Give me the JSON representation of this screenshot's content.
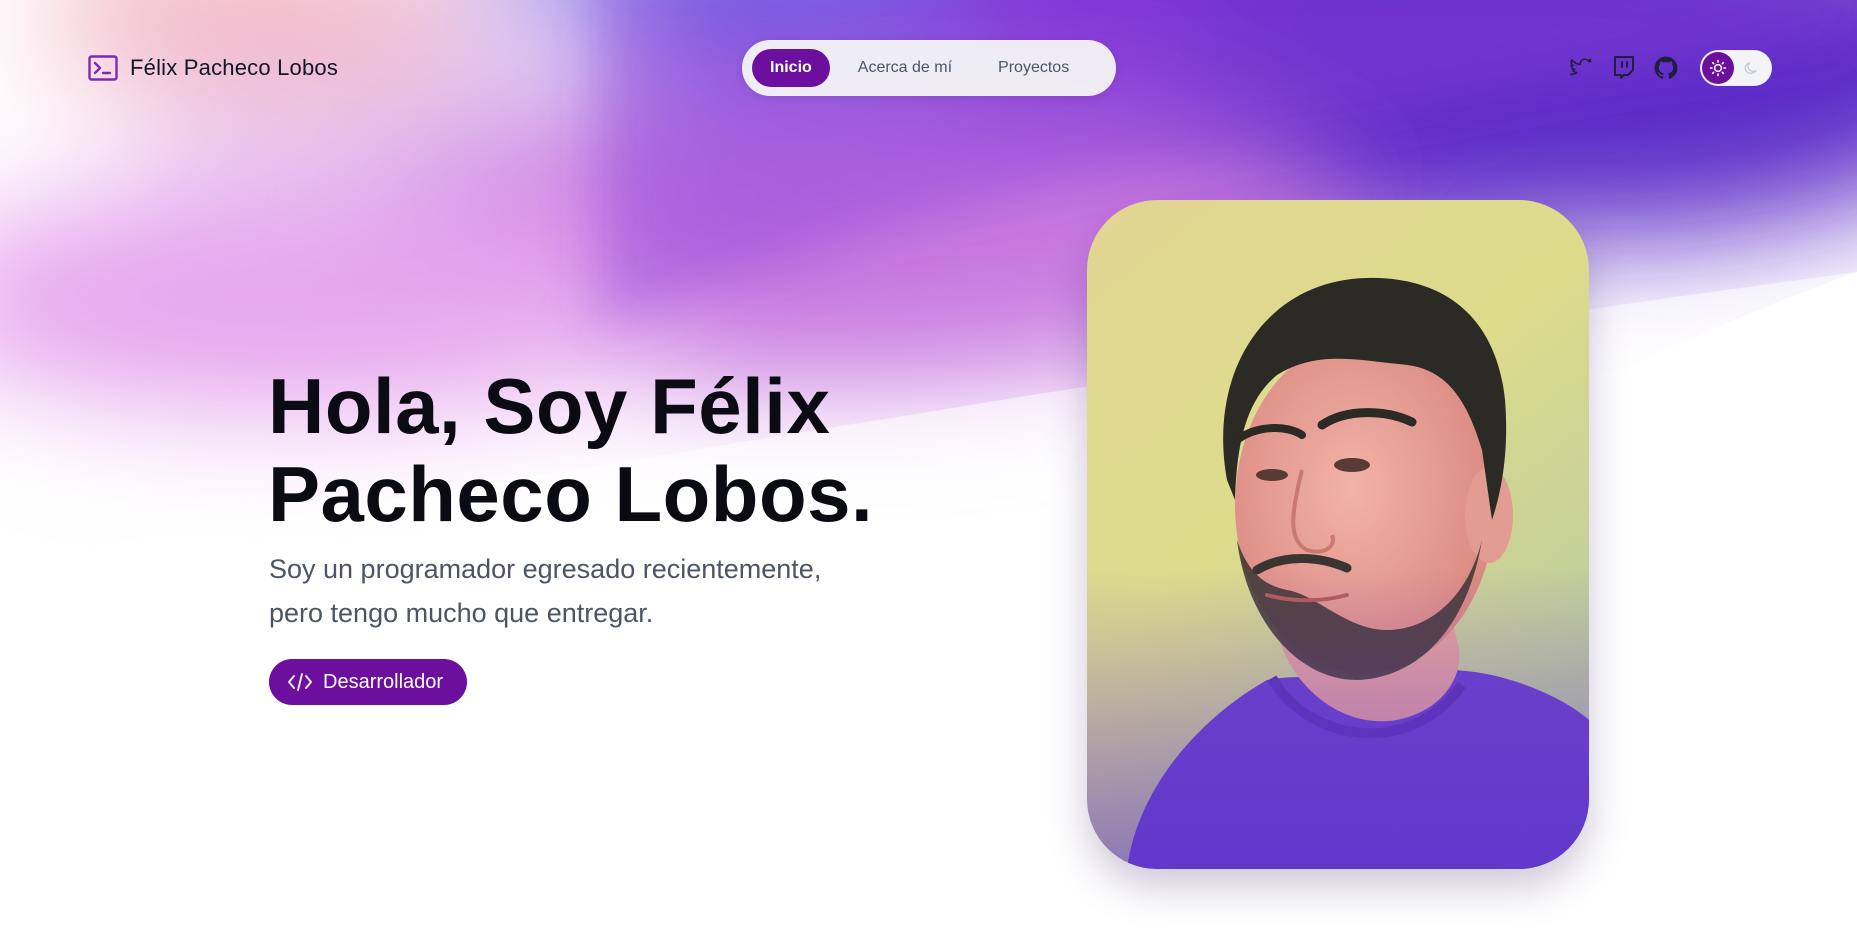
{
  "header": {
    "brand_name": "Félix Pacheco Lobos",
    "brand_icon": "terminal-icon",
    "nav": [
      {
        "label": "Inicio",
        "active": true
      },
      {
        "label": "Acerca de mí",
        "active": false
      },
      {
        "label": "Proyectos",
        "active": false
      }
    ],
    "social_icons": [
      "twitter-icon",
      "twitch-icon",
      "github-icon"
    ],
    "theme_toggle": {
      "selected": "light",
      "icons": [
        "sun-icon",
        "moon-icon"
      ]
    }
  },
  "hero": {
    "title_line1": "Hola, Soy Félix",
    "title_line2": "Pacheco Lobos.",
    "subtitle_line1": "Soy un programador egresado recientemente,",
    "subtitle_line2": "pero tengo mucho que entregar.",
    "badge_label": "Desarrollador",
    "badge_icon": "code-icon"
  },
  "colors": {
    "accent": "#6d0f9e",
    "gradient_purple": "#7a35d6",
    "gradient_pink": "#d58ae6",
    "text_dark": "#0b0b14",
    "text_muted": "#4b5563"
  }
}
